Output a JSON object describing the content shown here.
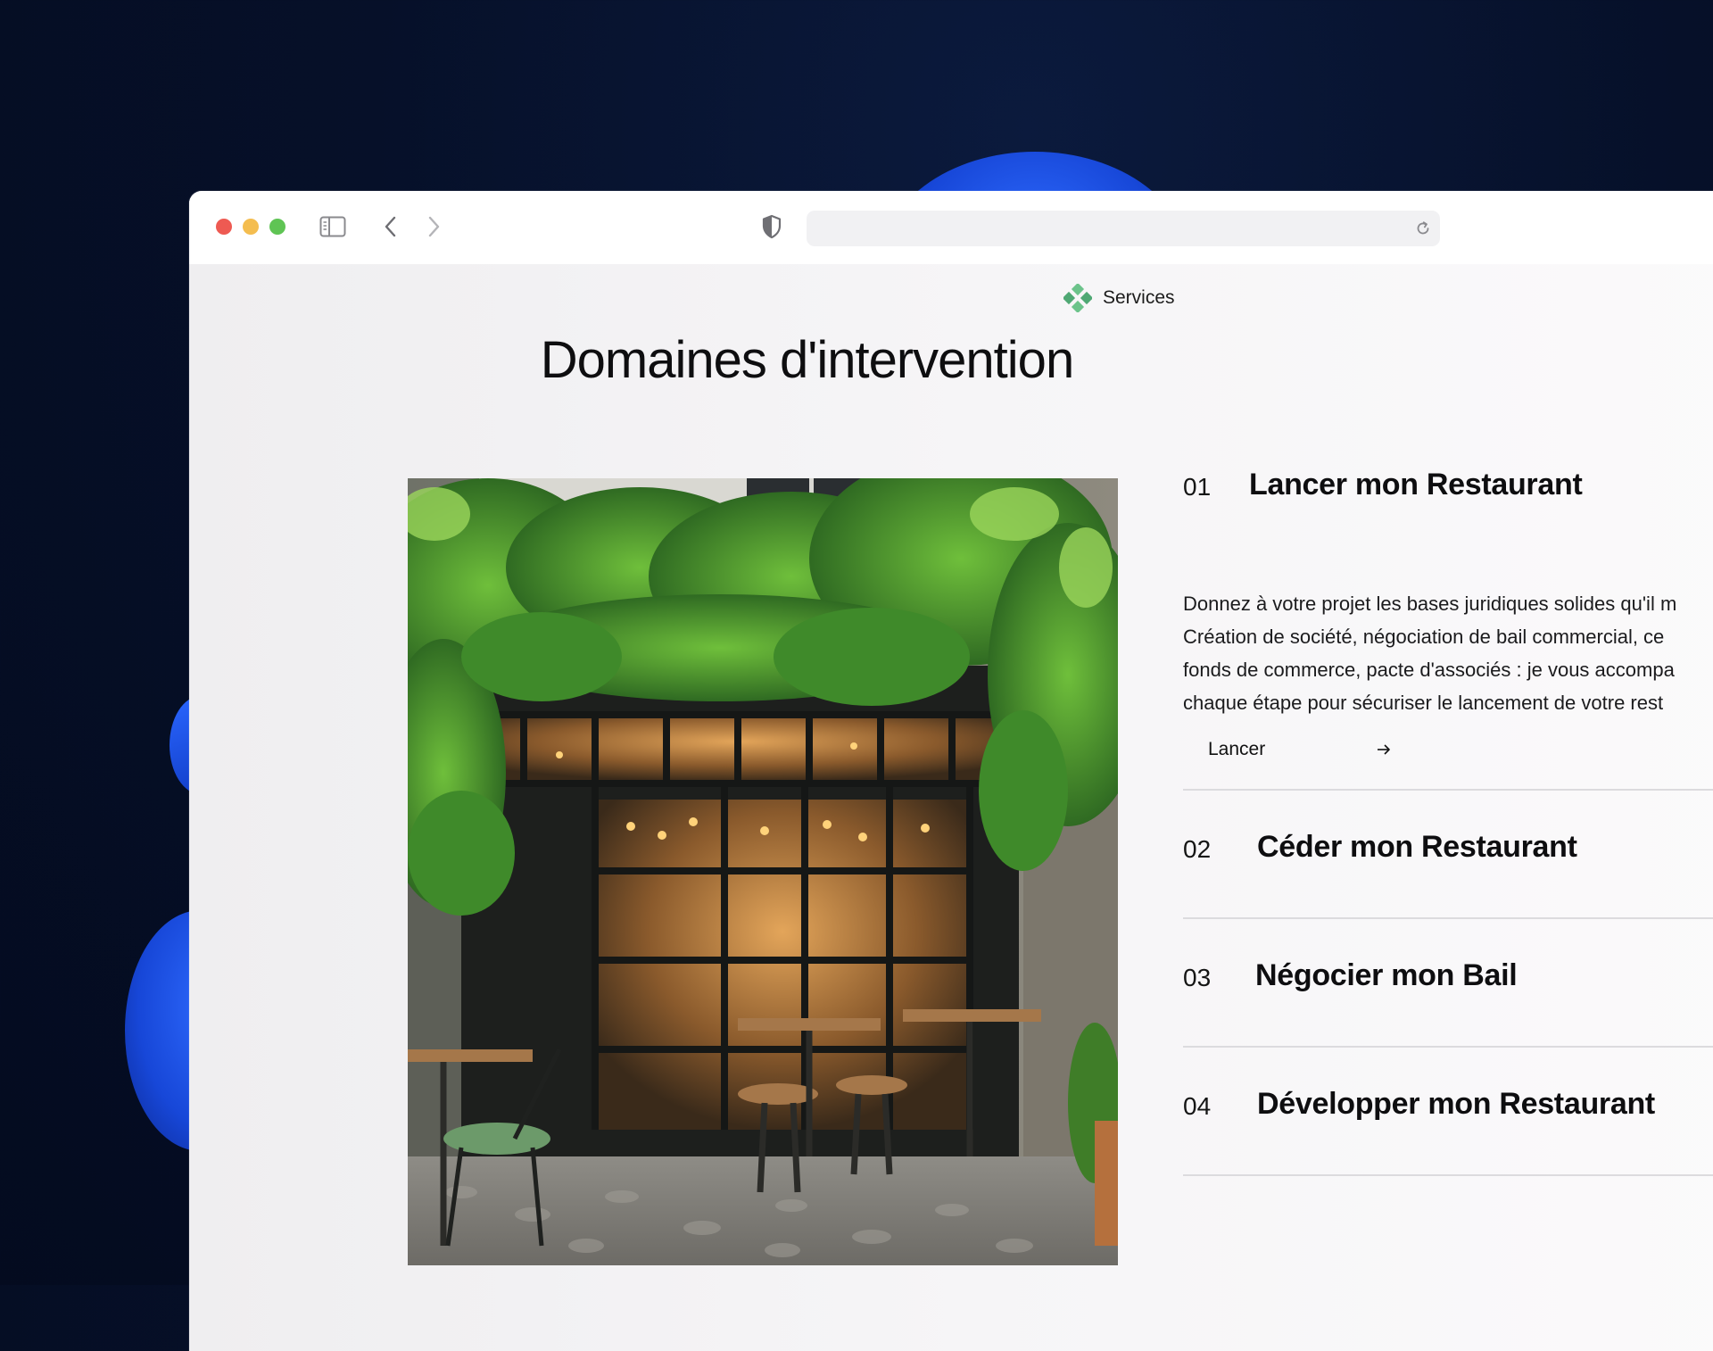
{
  "browser": {
    "url": ""
  },
  "section": {
    "eyebrow": "Services",
    "title": "Domaines d'intervention"
  },
  "image": {
    "subject": "restaurant-terrace-photo"
  },
  "services": [
    {
      "number": "01",
      "name": "Lancer mon Restaurant",
      "description_lines": [
        "Donnez à votre projet les bases juridiques solides qu'il m",
        "Création de société, négociation de bail commercial, ce",
        "fonds de commerce, pacte d'associés : je vous accompa",
        "chaque étape pour sécuriser le lancement de votre rest"
      ],
      "cta_label": "Lancer",
      "cta_icon": "arrow-right-icon"
    },
    {
      "number": "02",
      "name": "Céder mon Restaurant"
    },
    {
      "number": "03",
      "name": "Négocier mon Bail"
    },
    {
      "number": "04",
      "name": "Développer mon Restaurant"
    }
  ],
  "colors": {
    "accent_green": "#5dbb7f",
    "desktop_blue": "#1e55f0",
    "dark_background": "#061029"
  }
}
